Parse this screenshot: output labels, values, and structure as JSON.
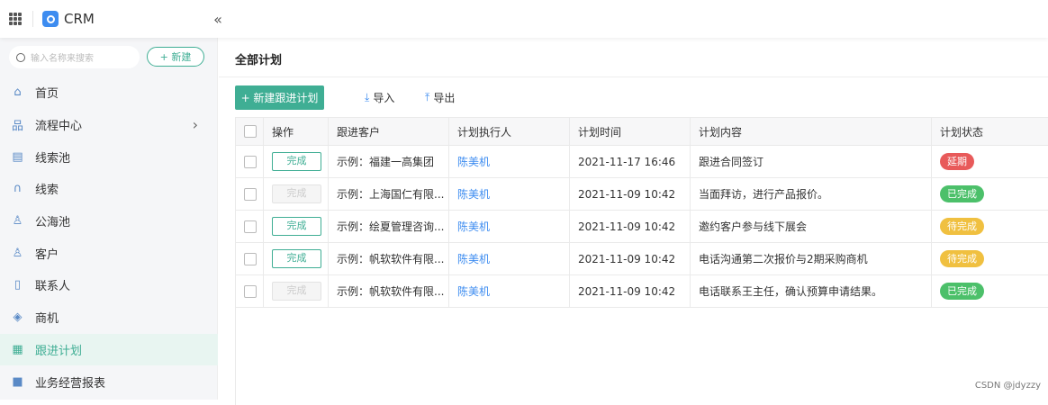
{
  "header": {
    "app_name": "CRM"
  },
  "sidebar": {
    "search_placeholder": "输入名称来搜索",
    "new_label": "+ 新建",
    "collapse_icon": "«",
    "items": [
      {
        "label": "首页",
        "icon": "⌂"
      },
      {
        "label": "流程中心",
        "icon": "品",
        "has_children": true
      },
      {
        "label": "线索池",
        "icon": "▤"
      },
      {
        "label": "线索",
        "icon": "∩"
      },
      {
        "label": "公海池",
        "icon": "♙"
      },
      {
        "label": "客户",
        "icon": "♙"
      },
      {
        "label": "联系人",
        "icon": "▯"
      },
      {
        "label": "商机",
        "icon": "◈"
      },
      {
        "label": "跟进计划",
        "icon": "▦",
        "active": true
      },
      {
        "label": "业务经营报表",
        "icon": "■"
      }
    ]
  },
  "main": {
    "title": "全部计划",
    "new_plan_label": "+ 新建跟进计划",
    "import_label": "导入",
    "export_label": "导出",
    "columns": [
      "操作",
      "跟进客户",
      "计划执行人",
      "计划时间",
      "计划内容",
      "计划状态"
    ],
    "rows": [
      {
        "action": "完成",
        "action_enabled": true,
        "customer": "示例：福建一高集团",
        "executor": "陈美机",
        "time": "2021-11-17 16:46",
        "content": "跟进合同签订",
        "status": "延期",
        "status_color": "#e85a5a"
      },
      {
        "action": "完成",
        "action_enabled": false,
        "customer": "示例：上海国仁有限...",
        "executor": "陈美机",
        "time": "2021-11-09 10:42",
        "content": "当面拜访，进行产品报价。",
        "status": "已完成",
        "status_color": "#4cc06a"
      },
      {
        "action": "完成",
        "action_enabled": true,
        "customer": "示例：绘夏管理咨询...",
        "executor": "陈美机",
        "time": "2021-11-09 10:42",
        "content": "邀约客户参与线下展会",
        "status": "待完成",
        "status_color": "#f0c040"
      },
      {
        "action": "完成",
        "action_enabled": true,
        "customer": "示例：帆软软件有限...",
        "executor": "陈美机",
        "time": "2021-11-09 10:42",
        "content": "电话沟通第二次报价与2期采购商机",
        "status": "待完成",
        "status_color": "#f0c040"
      },
      {
        "action": "完成",
        "action_enabled": false,
        "customer": "示例：帆软软件有限...",
        "executor": "陈美机",
        "time": "2021-11-09 10:42",
        "content": "电话联系王主任，确认预算申请结果。",
        "status": "已完成",
        "status_color": "#4cc06a"
      }
    ]
  },
  "watermark": "CSDN @jdyzzy"
}
